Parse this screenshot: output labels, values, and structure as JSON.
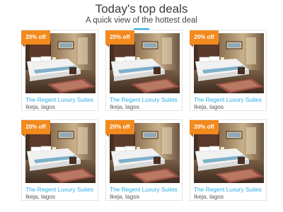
{
  "header": {
    "title": "Today's top deals",
    "subtitle": "A quick view of the hottest deal",
    "accent_color": "#29aee6"
  },
  "badge_color": "#f28a1e",
  "deals": [
    {
      "badge": "20% off",
      "name": "The Regent Luxury Suites",
      "location": "Ikeja, lagos",
      "image": "hotel-bedroom-photo"
    },
    {
      "badge": "20% off",
      "name": "The Regent Luxury Suites",
      "location": "Ikeja, lagos",
      "image": "hotel-bedroom-photo"
    },
    {
      "badge": "20% off",
      "name": "The Regent Luxury Suites",
      "location": "Ikeja, lagos",
      "image": "hotel-bedroom-photo"
    },
    {
      "badge": "20% off",
      "name": "The Regent Luxury Suites",
      "location": "Ikeja, lagos",
      "image": "hotel-bedroom-photo"
    },
    {
      "badge": "20% off",
      "name": "The Regent Luxury Suites",
      "location": "Ikeja, lagos",
      "image": "hotel-bedroom-photo"
    },
    {
      "badge": "20% off",
      "name": "The Regent Luxury Suites",
      "location": "Ikeja, lagos",
      "image": "hotel-bedroom-photo"
    }
  ]
}
